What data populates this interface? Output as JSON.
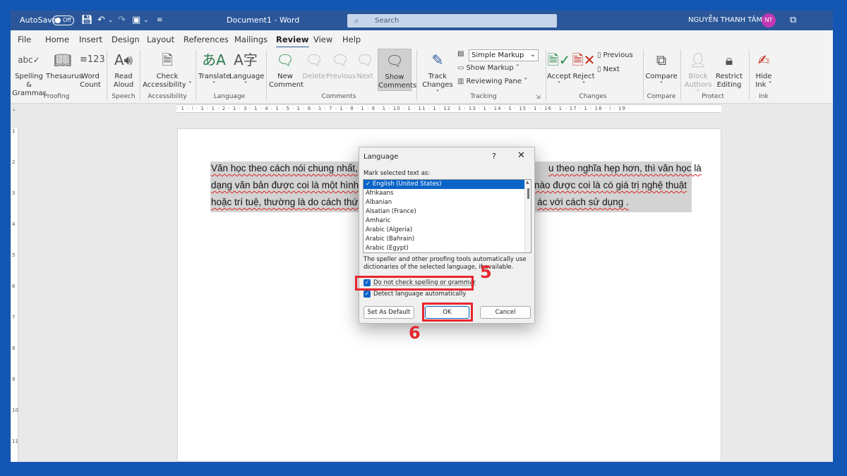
{
  "titlebar": {
    "autosave_label": "AutoSave",
    "autosave_state": "Off",
    "document_title": "Document1  -  Word",
    "search_placeholder": "Search",
    "user_name": "NGUYỄN THANH TÂM",
    "user_initials": "NT"
  },
  "menu": {
    "tabs": [
      "File",
      "Home",
      "Insert",
      "Design",
      "Layout",
      "References",
      "Mailings",
      "Review",
      "View",
      "Help"
    ],
    "active": "Review"
  },
  "ribbon": {
    "groups": [
      "Proofing",
      "Speech",
      "Accessibility",
      "Language",
      "Comments",
      "Tracking",
      "Changes",
      "Compare",
      "Protect",
      "Ink"
    ],
    "spelling": [
      "Spelling &",
      "Grammar"
    ],
    "thesaurus": "Thesaurus",
    "word_count": [
      "Word",
      "Count"
    ],
    "read_aloud": [
      "Read",
      "Aloud"
    ],
    "check_accessibility": [
      "Check",
      "Accessibility ˅"
    ],
    "translate": [
      "Translate",
      "˅"
    ],
    "language": [
      "Language",
      "˅"
    ],
    "new_comment": [
      "New",
      "Comment"
    ],
    "delete": "Delete",
    "previous": "Previous",
    "next": "Next",
    "show_comments": [
      "Show",
      "Comments"
    ],
    "track_changes": [
      "Track",
      "Changes ˅"
    ],
    "simple_markup": "Simple Markup",
    "show_markup": "Show Markup ˅",
    "reviewing_pane": "Reviewing Pane  ˅",
    "accept": [
      "Accept",
      "˅"
    ],
    "reject": [
      "Reject",
      "˅"
    ],
    "changes_previous": "Previous",
    "changes_next": "Next",
    "compare": [
      "Compare",
      "˅"
    ],
    "block_authors": [
      "Block",
      "Authors ˅"
    ],
    "restrict_editing": [
      "Restrict",
      "Editing"
    ],
    "hide_ink": [
      "Hide",
      "Ink ˅"
    ]
  },
  "ruler": {
    "horizontal": "· 1 · ⁞ · 1 · 1 · 2 · 1 · 3 · 1 · 4 · 1 · 5 · 1 · 6 · 1 · 7 · 1 · 8 · 1 · 9 · 1 · 10 · 1 · 11 · 1 · 12 · 1 · 13 · 1 · 14 · 1 · 15 · 1 · 16 · 1 · 17 · 1 · 18 · ⁞ · 19 ·",
    "vertical": [
      "1",
      "2",
      "3",
      "4",
      "5",
      "6",
      "7",
      "8",
      "9",
      "10",
      "11"
    ]
  },
  "document": {
    "lines": [
      [
        "Văn học theo cách nói chung nhất,",
        "u theo nghĩa hẹp hơn, thì văn học là"
      ],
      [
        "dạng văn bản được coi là một hình",
        "nào được coi là có giá trị nghệ thuật"
      ],
      [
        "hoặc trí tuệ, thường là do cách thức",
        "ác với cách sử dụng ."
      ]
    ]
  },
  "dialog": {
    "title": "Language",
    "help": "?",
    "close": "✕",
    "mark_label": "Mark selected text as:",
    "languages": [
      "English (United States)",
      "Afrikaans",
      "Albanian",
      "Alsatian (France)",
      "Amharic",
      "Arabic (Algeria)",
      "Arabic (Bahrain)",
      "Arabic (Egypt)"
    ],
    "selected_index": 0,
    "info_text": "The speller and other proofing tools automatically use dictionaries of the selected language, if available.",
    "checkbox_no_check": "Do not check spelling or grammar",
    "checkbox_detect": "Detect language automatically",
    "set_default": "Set As Default",
    "ok": "OK",
    "cancel": "Cancel"
  },
  "annotations": {
    "step5": "5",
    "step6": "6",
    "color": "#e8262e"
  },
  "colors": {
    "frame": "#1356b3",
    "titlebar": "#2b579a",
    "selection": "#0a64c8"
  }
}
